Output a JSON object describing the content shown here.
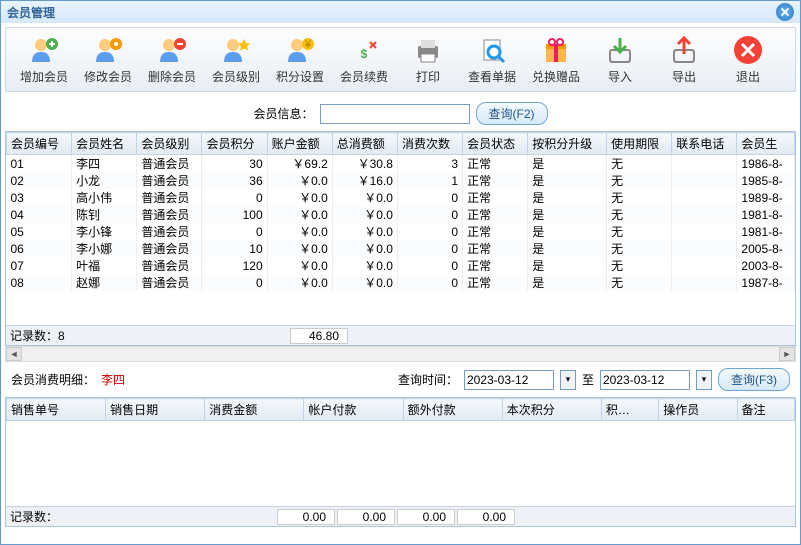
{
  "title": "会员管理",
  "toolbar": [
    {
      "name": "add-member",
      "label": "增加会员",
      "svg": "person-plus",
      "c": "#4caf50"
    },
    {
      "name": "edit-member",
      "label": "修改会员",
      "svg": "person-gear",
      "c": "#ff9800"
    },
    {
      "name": "del-member",
      "label": "删除会员",
      "svg": "person-minus",
      "c": "#f44336"
    },
    {
      "name": "member-level",
      "label": "会员级别",
      "svg": "person-star",
      "c": "#ffc107"
    },
    {
      "name": "points-set",
      "label": "积分设置",
      "svg": "person-coin",
      "c": "#ff5722"
    },
    {
      "name": "renew",
      "label": "会员续费",
      "svg": "money",
      "c": "#4caf50"
    },
    {
      "name": "print",
      "label": "打印",
      "svg": "printer",
      "c": "#2196f3"
    },
    {
      "name": "view-doc",
      "label": "查看单据",
      "svg": "search-doc",
      "c": "#2196f3"
    },
    {
      "name": "redeem",
      "label": "兑换赠品",
      "svg": "gift",
      "c": "#e91e63"
    },
    {
      "name": "import",
      "label": "导入",
      "svg": "import",
      "c": "#4caf50"
    },
    {
      "name": "export",
      "label": "导出",
      "svg": "export",
      "c": "#f44336"
    },
    {
      "name": "exit",
      "label": "退出",
      "svg": "exit",
      "c": "#f44336"
    }
  ],
  "search": {
    "label": "会员信息：",
    "value": "",
    "btn": "查询(F2)"
  },
  "cols": [
    "会员编号",
    "会员姓名",
    "会员级别",
    "会员积分",
    "账户金额",
    "总消费额",
    "消费次数",
    "会员状态",
    "按积分升级",
    "使用期限",
    "联系电话",
    "会员生"
  ],
  "rows": [
    {
      "id": "01",
      "name": "李四",
      "lvl": "普通会员",
      "pts": "30",
      "bal": "￥69.2",
      "spend": "￥30.8",
      "cnt": "3",
      "st": "正常",
      "up": "是",
      "exp": "无",
      "tel": "",
      "bd": "1986-8-"
    },
    {
      "id": "02",
      "name": "小龙",
      "lvl": "普通会员",
      "pts": "36",
      "bal": "￥0.0",
      "spend": "￥16.0",
      "cnt": "1",
      "st": "正常",
      "up": "是",
      "exp": "无",
      "tel": "",
      "bd": "1985-8-"
    },
    {
      "id": "03",
      "name": "高小伟",
      "lvl": "普通会员",
      "pts": "0",
      "bal": "￥0.0",
      "spend": "￥0.0",
      "cnt": "0",
      "st": "正常",
      "up": "是",
      "exp": "无",
      "tel": "",
      "bd": "1989-8-"
    },
    {
      "id": "04",
      "name": "陈钊",
      "lvl": "普通会员",
      "pts": "100",
      "bal": "￥0.0",
      "spend": "￥0.0",
      "cnt": "0",
      "st": "正常",
      "up": "是",
      "exp": "无",
      "tel": "",
      "bd": "1981-8-"
    },
    {
      "id": "05",
      "name": "李小锋",
      "lvl": "普通会员",
      "pts": "0",
      "bal": "￥0.0",
      "spend": "￥0.0",
      "cnt": "0",
      "st": "正常",
      "up": "是",
      "exp": "无",
      "tel": "",
      "bd": "1981-8-"
    },
    {
      "id": "06",
      "name": "李小娜",
      "lvl": "普通会员",
      "pts": "10",
      "bal": "￥0.0",
      "spend": "￥0.0",
      "cnt": "0",
      "st": "正常",
      "up": "是",
      "exp": "无",
      "tel": "",
      "bd": "2005-8-"
    },
    {
      "id": "07",
      "name": "叶福",
      "lvl": "普通会员",
      "pts": "120",
      "bal": "￥0.0",
      "spend": "￥0.0",
      "cnt": "0",
      "st": "正常",
      "up": "是",
      "exp": "无",
      "tel": "",
      "bd": "2003-8-"
    },
    {
      "id": "08",
      "name": "赵娜",
      "lvl": "普通会员",
      "pts": "0",
      "bal": "￥0.0",
      "spend": "￥0.0",
      "cnt": "0",
      "st": "正常",
      "up": "是",
      "exp": "无",
      "tel": "",
      "bd": "1987-8-"
    }
  ],
  "summary1": {
    "rec_label": "记录数：",
    "rec": "8",
    "total": "46.80"
  },
  "detail": {
    "label": "会员消费明细：",
    "name": "李四",
    "time_label": "查询时间：",
    "from": "2023-03-12",
    "to": "2023-03-12",
    "to_label": "至",
    "btn": "查询(F3)"
  },
  "cols2": [
    "销售单号",
    "销售日期",
    "消费金额",
    "帐户付款",
    "额外付款",
    "本次积分",
    "积…",
    "操作员",
    "备注"
  ],
  "summary2": {
    "rec_label": "记录数：",
    "v1": "0.00",
    "v2": "0.00",
    "v3": "0.00",
    "v4": "0.00"
  }
}
